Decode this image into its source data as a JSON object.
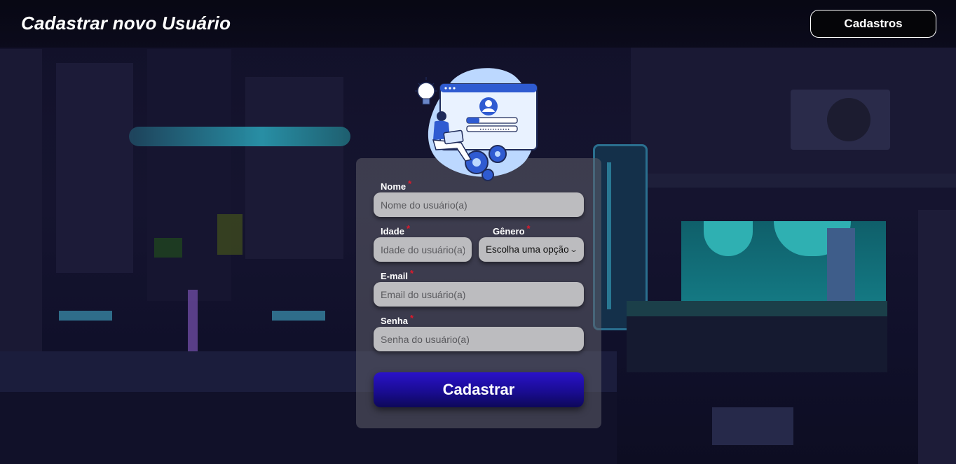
{
  "header": {
    "title": "Cadastrar novo Usuário",
    "nav_button_label": "Cadastros"
  },
  "form": {
    "fields": {
      "nome": {
        "label": "Nome",
        "placeholder": "Nome do usuário(a)",
        "value": ""
      },
      "idade": {
        "label": "Idade",
        "placeholder": "Idade do usuário(a)",
        "value": ""
      },
      "genero": {
        "label": "Gênero",
        "selected": "Escolha uma opção"
      },
      "email": {
        "label": "E-mail",
        "placeholder": "Email do usuário(a)",
        "value": ""
      },
      "senha": {
        "label": "Senha",
        "placeholder": "Senha do usuário(a)",
        "value": ""
      }
    },
    "required_marker": "*",
    "submit_label": "Cadastrar"
  },
  "icons": {
    "illustration": "user-registration-illustration",
    "select_arrow": "chevron-down-icon"
  },
  "colors": {
    "background": "#13122c",
    "required": "#e0192b",
    "submit": "#1a0c92",
    "card": "#5f5f69"
  }
}
